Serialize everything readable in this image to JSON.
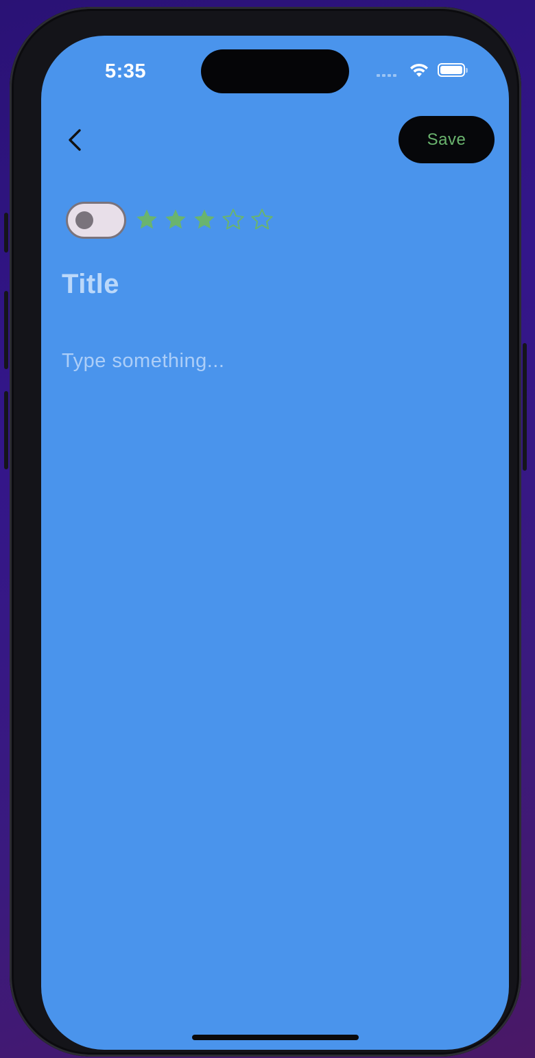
{
  "status_bar": {
    "time": "5:35",
    "wifi_icon": "wifi-icon",
    "battery_icon": "battery-icon",
    "signal_icon": "cellular-signal-icon"
  },
  "toolbar": {
    "back_icon": "chevron-left-icon",
    "save_label": "Save"
  },
  "editor": {
    "favorite_toggle_on": false,
    "rating": 3,
    "rating_max": 5,
    "title_placeholder": "Title",
    "body_placeholder": "Type something..."
  },
  "colors": {
    "background": "#4a94ec",
    "save_button_bg": "#06070a",
    "save_button_text": "#6ab46e",
    "star": "#6ab46e",
    "toggle_track": "#e8dfe9",
    "toggle_border": "#7a737c"
  }
}
